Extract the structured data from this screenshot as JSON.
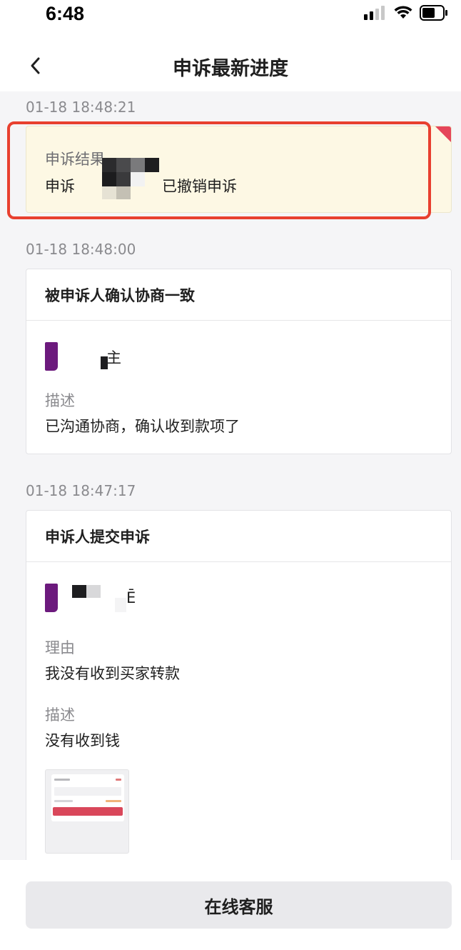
{
  "status_bar": {
    "time": "6:48"
  },
  "nav": {
    "title": "申诉最新进度"
  },
  "entries": [
    {
      "timestamp": "01-18 18:48:21",
      "result": {
        "label": "申诉结果",
        "value_prefix": "申诉",
        "value_suffix": "已撤销申诉"
      }
    },
    {
      "timestamp": "01-18 18:48:00",
      "title": "被申诉人确认协商一致",
      "user_fragment": "主",
      "desc_label": "描述",
      "desc_value": "已沟通协商，确认收到款项了"
    },
    {
      "timestamp": "01-18 18:47:17",
      "title": "申诉人提交申诉",
      "user_fragment": "Ē",
      "reason_label": "理由",
      "reason_value": "我没有收到买家转款",
      "desc_label": "描述",
      "desc_value": "没有收到钱"
    }
  ],
  "bottom": {
    "button_label": "在线客服"
  },
  "colors": {
    "highlight": "#e8402f",
    "avatar": "#6c1a7d",
    "corner": "#e5455a"
  }
}
